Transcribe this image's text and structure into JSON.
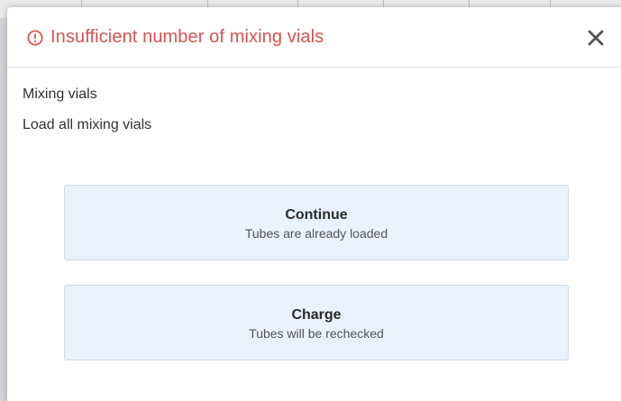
{
  "dialog": {
    "title": "Insufficient number of mixing vials",
    "title_color": "#d9534f",
    "title_icon": "alert-circle-icon",
    "close_icon": "close-icon"
  },
  "body": {
    "line_1": "Mixing vials",
    "line_2": "Load all mixing vials"
  },
  "options": [
    {
      "title": "Continue",
      "subtitle": "Tubes are already loaded"
    },
    {
      "title": "Charge",
      "subtitle": "Tubes will be rechecked"
    }
  ],
  "colors": {
    "option_background": "#e9f1fb",
    "option_border": "#cfd9e5"
  }
}
